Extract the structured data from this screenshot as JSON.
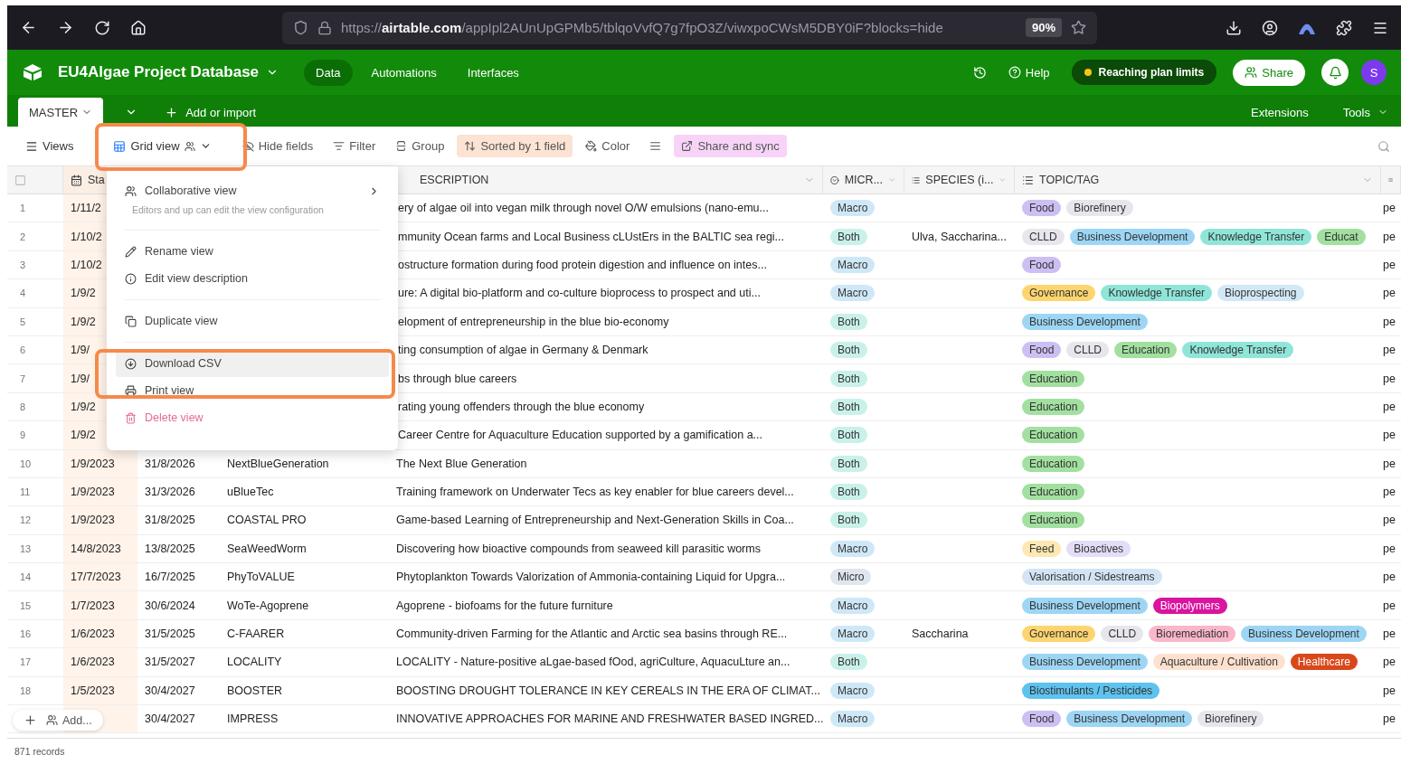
{
  "browser": {
    "url_prefix": "https://",
    "url_domain": "airtable.com",
    "url_path": "/appIpl2AUnUpGPMb5/tblqoVvfQ7g7fpO3Z/viwxpoCWsM5DBY0iF?blocks=hide",
    "zoom": "90%"
  },
  "header": {
    "title": "EU4Algae Project Database",
    "nav": [
      {
        "label": "Data",
        "selected": true
      },
      {
        "label": "Automations",
        "selected": false
      },
      {
        "label": "Interfaces",
        "selected": false
      }
    ],
    "help": "Help",
    "plan_notice": "Reaching plan limits",
    "share": "Share",
    "avatar": "S"
  },
  "tabbar": {
    "tabs": [
      {
        "label": "MASTER",
        "selected": true
      }
    ],
    "add": "Add or import",
    "right": [
      "Extensions",
      "Tools"
    ]
  },
  "toolbar": {
    "views": "Views",
    "view_name": "Grid view",
    "items": [
      {
        "kind": "hide",
        "label": "Hide fields"
      },
      {
        "kind": "filter",
        "label": "Filter"
      },
      {
        "kind": "group",
        "label": "Group"
      },
      {
        "kind": "sort",
        "label": "Sorted by 1 field"
      },
      {
        "kind": "color",
        "label": "Color"
      },
      {
        "kind": "height"
      },
      {
        "kind": "sync",
        "label": "Share and sync"
      }
    ]
  },
  "table": {
    "columns": [
      {
        "kind": "date",
        "label": "Sta",
        "sorted": true
      },
      {
        "kind": "text",
        "label": "ESCRIPTION",
        "sorted": false
      },
      {
        "kind": "select",
        "label": "MICR...",
        "sorted": false
      },
      {
        "kind": "multi",
        "label": "SPECIES (i...",
        "sorted": false
      },
      {
        "kind": "tags",
        "label": "TOPIC/TAG",
        "sorted": false
      }
    ],
    "rows": [
      {
        "number": "1",
        "start": "1/11/2",
        "description": "ery of algae oil into vegan milk through novel O/W emulsions (nano-emu...",
        "micro": {
          "label": "Macro",
          "color": "#cfe8f7"
        },
        "tags": [
          {
            "label": "Food",
            "color": "#cdbff3"
          },
          {
            "label": "Biorefinery",
            "color": "#e6e6ec"
          }
        ],
        "last": "pe"
      },
      {
        "number": "2",
        "start": "1/10/2",
        "description": "mmunity Ocean farms and Local Business cLUstErs in the BALTIC sea regi...",
        "micro": {
          "label": "Both",
          "color": "#c9f1ea"
        },
        "species": "Ulva, Saccharina...",
        "tags": [
          {
            "label": "CLLD",
            "color": "#e6e6ec"
          },
          {
            "label": "Business Development",
            "color": "#9dd6f5"
          },
          {
            "label": "Knowledge Transfer",
            "color": "#8fe6d8"
          },
          {
            "label": "Educat",
            "color": "#a2e0a0"
          }
        ],
        "last": "pe"
      },
      {
        "number": "3",
        "start": "1/10/2",
        "description": "ostructure formation during food protein digestion and influence on intes...",
        "micro": {
          "label": "Macro",
          "color": "#cfe8f7"
        },
        "tags": [
          {
            "label": "Food",
            "color": "#cdbff3"
          }
        ],
        "last": "pe"
      },
      {
        "number": "4",
        "start": "1/9/2",
        "description": "ure: A digital bio-platform and co-culture bioprocess to prospect and uti...",
        "micro": {
          "label": "Macro",
          "color": "#cfe8f7"
        },
        "tags": [
          {
            "label": "Governance",
            "color": "#fdd56f"
          },
          {
            "label": "Knowledge Transfer",
            "color": "#8fe6d8"
          },
          {
            "label": "Bioprospecting",
            "color": "#d3e8f6"
          }
        ],
        "last": "pe"
      },
      {
        "number": "5",
        "start": "1/9/2",
        "description": "elopment of entrepreneurship in the blue bio-economy",
        "micro": {
          "label": "Both",
          "color": "#c9f1ea"
        },
        "tags": [
          {
            "label": "Business Development",
            "color": "#9dd6f5"
          }
        ],
        "last": "pe"
      },
      {
        "number": "6",
        "start": "1/9/",
        "description": "ting consumption of algae in Germany & Denmark",
        "micro": {
          "label": "Both",
          "color": "#c9f1ea"
        },
        "tags": [
          {
            "label": "Food",
            "color": "#cdbff3"
          },
          {
            "label": "CLLD",
            "color": "#e6e6ec"
          },
          {
            "label": "Education",
            "color": "#a2e0a0"
          },
          {
            "label": "Knowledge Transfer",
            "color": "#8fe6d8"
          }
        ],
        "last": "pe"
      },
      {
        "number": "7",
        "start": "1/9/",
        "description": "bs through blue careers",
        "micro": {
          "label": "Both",
          "color": "#c9f1ea"
        },
        "tags": [
          {
            "label": "Education",
            "color": "#a2e0a0"
          }
        ],
        "last": "pe"
      },
      {
        "number": "8",
        "start": "1/9/2",
        "description": "rating young offenders through the blue economy",
        "micro": {
          "label": "Both",
          "color": "#c9f1ea"
        },
        "tags": [
          {
            "label": "Education",
            "color": "#a2e0a0"
          }
        ],
        "last": "pe"
      },
      {
        "number": "9",
        "start": "1/9/2",
        "description": "Career Centre for Aquaculture Education supported by a gamification a...",
        "micro": {
          "label": "Both",
          "color": "#c9f1ea"
        },
        "tags": [
          {
            "label": "Education",
            "color": "#a2e0a0"
          }
        ],
        "last": "pe"
      },
      {
        "number": "10",
        "start": "1/9/2023",
        "end": "31/8/2026",
        "name": "NextBlueGeneration",
        "description": "The Next Blue Generation",
        "micro": {
          "label": "Both",
          "color": "#c9f1ea"
        },
        "tags": [
          {
            "label": "Education",
            "color": "#a2e0a0"
          }
        ],
        "last": "pe"
      },
      {
        "number": "11",
        "start": "1/9/2023",
        "end": "31/3/2026",
        "name": "uBlueTec",
        "description": "Training framework on Underwater Tecs as key enabler for blue careers devel...",
        "micro": {
          "label": "Both",
          "color": "#c9f1ea"
        },
        "tags": [
          {
            "label": "Education",
            "color": "#a2e0a0"
          }
        ],
        "last": "pe"
      },
      {
        "number": "12",
        "start": "1/9/2023",
        "end": "31/8/2025",
        "name": "COASTAL PRO",
        "description": "Game-based Learning of Entrepreneurship and Next-Generation Skills in Coa...",
        "micro": {
          "label": "Both",
          "color": "#c9f1ea"
        },
        "tags": [
          {
            "label": "Education",
            "color": "#a2e0a0"
          }
        ],
        "last": "pe"
      },
      {
        "number": "13",
        "start": "14/8/2023",
        "end": "13/8/2025",
        "name": "SeaWeedWorm",
        "description": "Discovering how bioactive compounds from seaweed kill parasitic worms",
        "micro": {
          "label": "Macro",
          "color": "#cfe8f7"
        },
        "tags": [
          {
            "label": "Feed",
            "color": "#fde8b2"
          },
          {
            "label": "Bioactives",
            "color": "#e4ddf7"
          }
        ],
        "last": "pe"
      },
      {
        "number": "14",
        "start": "17/7/2023",
        "end": "16/7/2025",
        "name": "PhyToVALUE",
        "description": "Phytoplankton Towards Valorization of Ammonia-containing Liquid for Upgra...",
        "micro": {
          "label": "Micro",
          "color": "#dfe6ee"
        },
        "tags": [
          {
            "label": "Valorisation / Sidestreams",
            "color": "#d3e5f5"
          }
        ],
        "last": "pe"
      },
      {
        "number": "15",
        "start": "1/7/2023",
        "end": "30/6/2024",
        "name": "WoTe-Agoprene",
        "description": "Agoprene - biofoams for the future furniture",
        "micro": {
          "label": "Macro",
          "color": "#cfe8f7"
        },
        "tags": [
          {
            "label": "Business Development",
            "color": "#9dd6f5"
          },
          {
            "label": "Biopolymers",
            "color": "#d9149e"
          }
        ],
        "last": "pe"
      },
      {
        "number": "16",
        "start": "1/6/2023",
        "end": "31/5/2025",
        "name": "C-FAARER",
        "description": "Community-driven Farming for the Atlantic and Arctic sea basins through RE...",
        "micro": {
          "label": "Macro",
          "color": "#cfe8f7"
        },
        "species": "Saccharina",
        "tags": [
          {
            "label": "Governance",
            "color": "#fdd56f"
          },
          {
            "label": "CLLD",
            "color": "#e6e6ec"
          },
          {
            "label": "Bioremediation",
            "color": "#fab6cb"
          },
          {
            "label": "Business Development",
            "color": "#9dd6f5"
          }
        ],
        "last": "pe"
      },
      {
        "number": "17",
        "start": "1/6/2023",
        "end": "31/5/2027",
        "name": "LOCALITY",
        "description": "LOCALITY - Nature-positive aLgae-based fOod, agriCulture, AquacuLture an...",
        "micro": {
          "label": "Both",
          "color": "#c9f1ea"
        },
        "tags": [
          {
            "label": "Business Development",
            "color": "#9dd6f5"
          },
          {
            "label": "Aquaculture / Cultivation",
            "color": "#fde1ce"
          },
          {
            "label": "Healthcare",
            "color": "#d9481a"
          }
        ],
        "last": "pe"
      },
      {
        "number": "18",
        "start": "1/5/2023",
        "end": "30/4/2027",
        "name": "BOOSTER",
        "description": "BOOSTING DROUGHT TOLERANCE IN KEY CEREALS IN THE ERA OF CLIMAT...",
        "micro": {
          "label": "Macro",
          "color": "#cfe8f7"
        },
        "tags": [
          {
            "label": "Biostimulants / Pesticides",
            "color": "#5ec2ef"
          }
        ],
        "last": "pe"
      },
      {
        "end": "30/4/2027",
        "name": "IMPRESS",
        "description": "INNOVATIVE APPROACHES FOR MARINE AND FRESHWATER BASED INGRED...",
        "micro": {
          "label": "Macro",
          "color": "#cfe8f7"
        },
        "tags": [
          {
            "label": "Food",
            "color": "#cdbff3"
          },
          {
            "label": "Business Development",
            "color": "#9dd6f5"
          },
          {
            "label": "Biorefinery",
            "color": "#e6e6ec"
          }
        ],
        "last": "pe"
      }
    ],
    "add": "Add...",
    "footer": "871 records"
  },
  "menu": {
    "items": [
      {
        "kind": "collab",
        "label": "Collaborative view",
        "subtitle": "Editors and up can edit the view configuration",
        "selected": false,
        "danger": false
      },
      {
        "kind": "rename",
        "label": "Rename view",
        "selected": false,
        "danger": false
      },
      {
        "kind": "describe",
        "label": "Edit view description",
        "selected": false,
        "danger": false
      },
      {
        "kind": "duplicate",
        "label": "Duplicate view",
        "selected": false,
        "danger": false
      },
      {
        "kind": "download",
        "label": "Download CSV",
        "selected": true,
        "danger": false
      },
      {
        "kind": "print",
        "label": "Print view",
        "selected": false,
        "danger": false
      },
      {
        "kind": "delete",
        "label": "Delete view",
        "selected": false,
        "danger": true
      }
    ]
  }
}
